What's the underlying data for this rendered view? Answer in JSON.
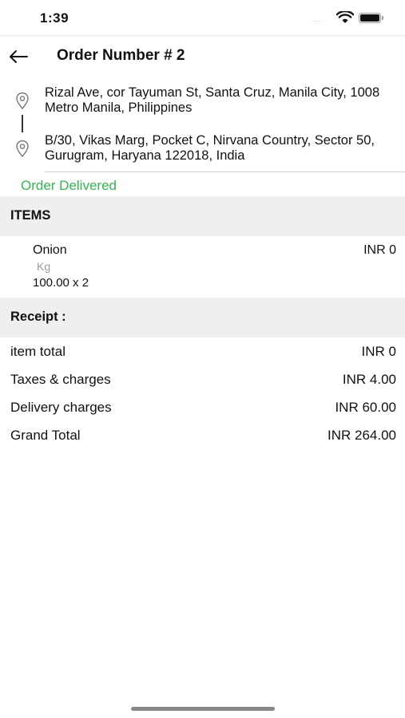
{
  "status_bar": {
    "time": "1:39",
    "signal": "....",
    "wifi_icon": "wifi-icon",
    "battery_icon": "battery-icon"
  },
  "header": {
    "back_icon": "arrow-left-icon",
    "title": "Order Number # 2"
  },
  "addresses": {
    "pickup": "Rizal Ave, cor Tayuman St, Santa Cruz, Manila City, 1008 Metro Manila, Philippines",
    "dropoff": "B/30, Vikas Marg, Pocket C, Nirvana Country, Sector 50, Gurugram, Haryana 122018, India",
    "pin_icon": "map-pin-icon"
  },
  "order_status": {
    "label": "Order Delivered",
    "color": "#2db84d"
  },
  "items_section": {
    "title": "ITEMS",
    "items": [
      {
        "name": "Onion",
        "unit": "Kg",
        "quantity": "100.00 x 2",
        "price": "INR 0"
      }
    ]
  },
  "receipt": {
    "title": "Receipt :",
    "rows": [
      {
        "label": "item total",
        "value": "INR 0"
      },
      {
        "label": "Taxes & charges",
        "value": "INR 4.00"
      },
      {
        "label": "Delivery charges",
        "value": "INR 60.00"
      },
      {
        "label": "Grand Total",
        "value": "INR 264.00"
      }
    ]
  }
}
